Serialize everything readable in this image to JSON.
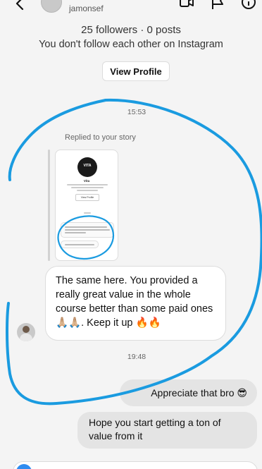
{
  "header": {
    "username": "jamonsef"
  },
  "profile_info": {
    "followers": "25 followers · 0 posts",
    "follow_status": "You don't follow each other on Instagram",
    "view_profile_label": "View Profile"
  },
  "thread": {
    "timestamp_1": "15:53",
    "replied_label": "Replied to your story",
    "story_preview": {
      "avatar_text": "VITA",
      "name": "Vita",
      "button_label": "View Profile"
    },
    "incoming_message": "The same here. You provided a really great value in the whole course better than some paid ones🙏🏼🙏🏼. Keep it up 🔥🔥",
    "timestamp_2": "19:48",
    "outgoing_message_1": "Appreciate that bro 😎",
    "outgoing_message_2": "Hope you start getting a ton of value from it"
  },
  "colors": {
    "annotation_stroke": "#1a9be0",
    "background": "#f4f4f4",
    "outgoing_bubble": "#e4e4e4"
  }
}
